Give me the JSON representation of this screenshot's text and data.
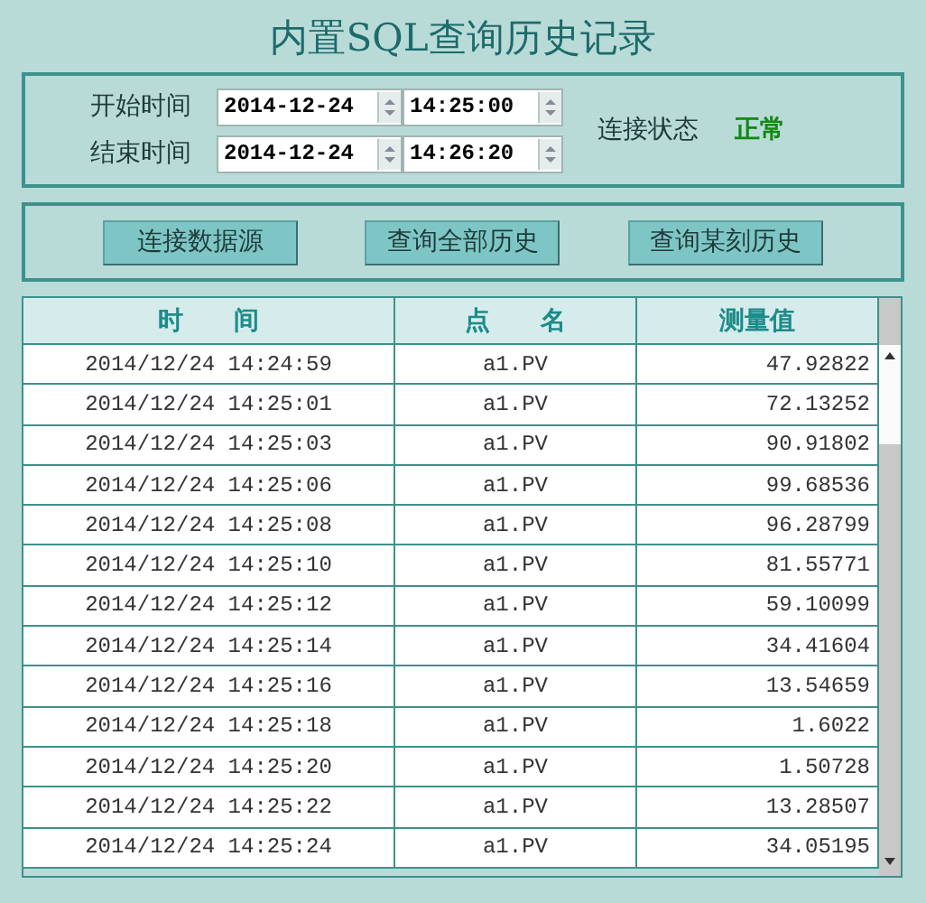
{
  "title": "内置SQL查询历史记录",
  "time_range": [
    {
      "label": "开始时间",
      "date": "2014-12-24",
      "time": "14:25:00"
    },
    {
      "label": "结束时间",
      "date": "2014-12-24",
      "time": "14:26:20"
    }
  ],
  "connection": {
    "label": "连接状态",
    "status": "正常"
  },
  "buttons": [
    "连接数据源",
    "查询全部历史",
    "查询某刻历史"
  ],
  "table": {
    "columns": [
      "时　　间",
      "点　　名",
      "测量值"
    ],
    "rows": [
      [
        "2014/12/24 14:24:59",
        "a1.PV",
        "47.92822"
      ],
      [
        "2014/12/24 14:25:01",
        "a1.PV",
        "72.13252"
      ],
      [
        "2014/12/24 14:25:03",
        "a1.PV",
        "90.91802"
      ],
      [
        "2014/12/24 14:25:06",
        "a1.PV",
        "99.68536"
      ],
      [
        "2014/12/24 14:25:08",
        "a1.PV",
        "96.28799"
      ],
      [
        "2014/12/24 14:25:10",
        "a1.PV",
        "81.55771"
      ],
      [
        "2014/12/24 14:25:12",
        "a1.PV",
        "59.10099"
      ],
      [
        "2014/12/24 14:25:14",
        "a1.PV",
        "34.41604"
      ],
      [
        "2014/12/24 14:25:16",
        "a1.PV",
        "13.54659"
      ],
      [
        "2014/12/24 14:25:18",
        "a1.PV",
        "1.6022"
      ],
      [
        "2014/12/24 14:25:20",
        "a1.PV",
        "1.50728"
      ],
      [
        "2014/12/24 14:25:22",
        "a1.PV",
        "13.28507"
      ],
      [
        "2014/12/24 14:25:24",
        "a1.PV",
        "34.05195"
      ]
    ]
  }
}
